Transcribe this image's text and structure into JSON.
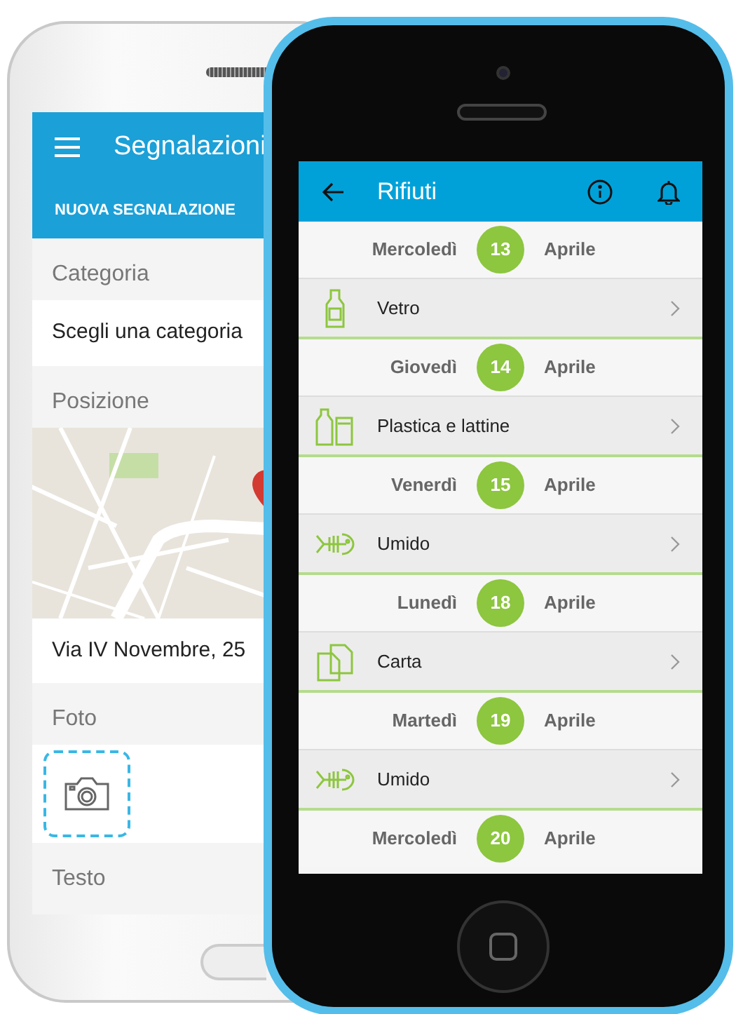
{
  "back_phone": {
    "app_bar": {
      "title": "Segnalazioni"
    },
    "tab": "NUOVA SEGNALAZIONE",
    "form": [
      {
        "header": "Categoria",
        "kind": "text",
        "value": "Scegli una categoria"
      },
      {
        "header": "Posizione",
        "kind": "map",
        "value": "Via IV Novembre, 25"
      },
      {
        "header": "Foto"
      },
      {
        "header": "Testo",
        "kind": "empty"
      }
    ]
  },
  "front_phone": {
    "app_bar": {
      "title": "Rifiuti"
    },
    "schedule": [
      {
        "weekday": "Mercoledì",
        "day": "13",
        "month": "Aprile",
        "waste": "Vetro",
        "kind": "bottle"
      },
      {
        "weekday": "Giovedì",
        "day": "14",
        "month": "Aprile",
        "waste": "Plastica e lattine",
        "kind": "bottles"
      },
      {
        "weekday": "Venerdì",
        "day": "15",
        "month": "Aprile",
        "waste": "Umido",
        "kind": "fish"
      },
      {
        "weekday": "Lunedì",
        "day": "18",
        "month": "Aprile",
        "waste": "Carta",
        "kind": "paper"
      },
      {
        "weekday": "Martedì",
        "day": "19",
        "month": "Aprile",
        "waste": "Umido",
        "kind": "fish"
      },
      {
        "weekday": "Mercoledì",
        "day": "20",
        "month": "Aprile"
      }
    ]
  }
}
